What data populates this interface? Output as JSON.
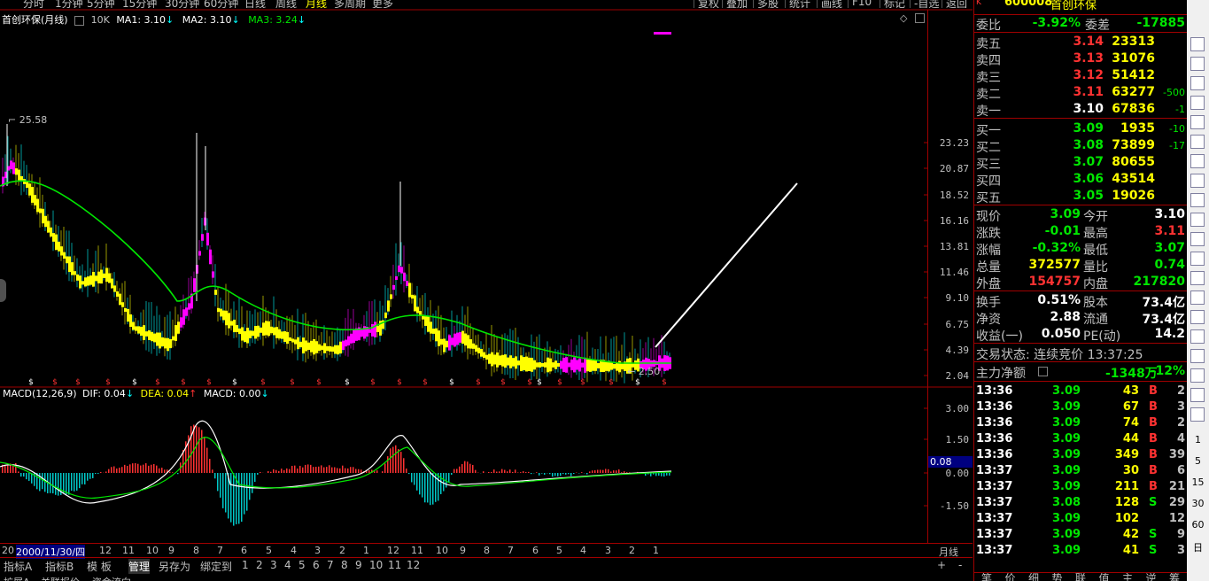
{
  "toolbar": {
    "periods": [
      "分时",
      "1分钟",
      "5分钟",
      "15分钟",
      "30分钟",
      "60分钟",
      "日线",
      "周线",
      "月线",
      "多周期",
      "更多"
    ],
    "active_period": "月线",
    "right_buttons": [
      "复权",
      "叠加",
      "多股",
      "统计",
      "画线",
      "F10",
      "标记",
      "-自选",
      "返回"
    ]
  },
  "main_chart": {
    "title": "首创环保(月线)",
    "vol_label": "10K",
    "ma1": "MA1: 3.10",
    "ma2": "MA2: 3.10",
    "ma3": "MA3: 3.24",
    "arrow": "↓",
    "y_ticks": [
      "23.23",
      "20.87",
      "18.52",
      "16.16",
      "13.81",
      "11.46",
      "9.10",
      "6.75",
      "4.39",
      "2.04"
    ],
    "high_label": "25.58",
    "low_label": "2.50",
    "colors": {
      "up": "#ff00ff",
      "down": "#ffff00",
      "ma_long": "#00e600",
      "frame": "#a00000"
    }
  },
  "macd": {
    "label": "MACD(12,26,9)",
    "dif": "DIF: 0.04",
    "dea": "DEA: 0.04",
    "macd_val": "MACD: 0.00",
    "y_ticks": [
      "3.00",
      "1.50",
      "0.00",
      "-1.50"
    ],
    "current": "0.08"
  },
  "date_axis": {
    "ticks": [
      "20",
      "2000/11/30/四",
      "12",
      "11",
      "10",
      "9",
      "8",
      "7",
      "6",
      "5",
      "4",
      "3",
      "2",
      "1",
      "12",
      "11",
      "10",
      "9",
      "8",
      "7",
      "6",
      "5",
      "4",
      "3",
      "2",
      "1"
    ],
    "period_label": "月线"
  },
  "tabs": {
    "items": [
      "指标A",
      "指标B",
      "模 板",
      "管理",
      "另存为",
      "绑定到",
      "1",
      "2",
      "3",
      "4",
      "5",
      "6",
      "7",
      "8",
      "9",
      "10",
      "11",
      "12"
    ],
    "active": "管理",
    "plus": "+",
    "minus": "-"
  },
  "extbar": {
    "items": [
      "扩展A",
      "关联报价",
      "资金流向"
    ]
  },
  "quote": {
    "code": "600008",
    "name": "首创环保",
    "weibi_label": "委比",
    "weibi": "-3.92%",
    "weicha_label": "委差",
    "weicha": "-17885",
    "sells": [
      {
        "label": "卖五",
        "price": "3.14",
        "vol": "23313",
        "chg": ""
      },
      {
        "label": "卖四",
        "price": "3.13",
        "vol": "31076",
        "chg": ""
      },
      {
        "label": "卖三",
        "price": "3.12",
        "vol": "51412",
        "chg": ""
      },
      {
        "label": "卖二",
        "price": "3.11",
        "vol": "63277",
        "chg": "-500"
      },
      {
        "label": "卖一",
        "price": "3.10",
        "vol": "67836",
        "chg": "-1"
      }
    ],
    "buys": [
      {
        "label": "买一",
        "price": "3.09",
        "vol": "1935",
        "chg": "-10"
      },
      {
        "label": "买二",
        "price": "3.08",
        "vol": "73899",
        "chg": "-17"
      },
      {
        "label": "买三",
        "price": "3.07",
        "vol": "80655",
        "chg": ""
      },
      {
        "label": "买四",
        "price": "3.06",
        "vol": "43514",
        "chg": ""
      },
      {
        "label": "买五",
        "price": "3.05",
        "vol": "19026",
        "chg": ""
      }
    ],
    "stats": [
      {
        "l1": "现价",
        "v1": "3.09",
        "l2": "今开",
        "v2": "3.10"
      },
      {
        "l1": "涨跌",
        "v1": "-0.01",
        "l2": "最高",
        "v2": "3.11"
      },
      {
        "l1": "涨幅",
        "v1": "-0.32%",
        "l2": "最低",
        "v2": "3.07"
      },
      {
        "l1": "总量",
        "v1": "372577",
        "l2": "量比",
        "v2": "0.74"
      },
      {
        "l1": "外盘",
        "v1": "154757",
        "l2": "内盘",
        "v2": "217820"
      }
    ],
    "stats2": [
      {
        "l1": "换手",
        "v1": "0.51%",
        "l2": "股本",
        "v2": "73.4亿"
      },
      {
        "l1": "净资",
        "v1": "2.88",
        "l2": "流通",
        "v2": "73.4亿"
      },
      {
        "l1": "收益(一)",
        "v1": "0.050",
        "l2": "PE(动)",
        "v2": "14.2"
      }
    ],
    "trade_status": "交易状态: 连续竞价 13:37:25",
    "main_flow_label": "主力净额",
    "main_flow": "-1348万",
    "main_flow_pct": "-12%"
  },
  "trades": [
    {
      "t": "13:36",
      "p": "3.09",
      "v": "43",
      "s": "B",
      "n": "2"
    },
    {
      "t": "13:36",
      "p": "3.09",
      "v": "67",
      "s": "B",
      "n": "3"
    },
    {
      "t": "13:36",
      "p": "3.09",
      "v": "74",
      "s": "B",
      "n": "2"
    },
    {
      "t": "13:36",
      "p": "3.09",
      "v": "44",
      "s": "B",
      "n": "4"
    },
    {
      "t": "13:36",
      "p": "3.09",
      "v": "349",
      "s": "B",
      "n": "39"
    },
    {
      "t": "13:37",
      "p": "3.09",
      "v": "30",
      "s": "B",
      "n": "6"
    },
    {
      "t": "13:37",
      "p": "3.09",
      "v": "211",
      "s": "B",
      "n": "21"
    },
    {
      "t": "13:37",
      "p": "3.08",
      "v": "128",
      "s": "S",
      "n": "29"
    },
    {
      "t": "13:37",
      "p": "3.09",
      "v": "102",
      "s": "",
      "n": "12"
    },
    {
      "t": "13:37",
      "p": "3.09",
      "v": "42",
      "s": "S",
      "n": "9"
    },
    {
      "t": "13:37",
      "p": "3.09",
      "v": "41",
      "s": "S",
      "n": "3"
    }
  ],
  "bottom_tabs": [
    "笔",
    "价",
    "细",
    "势",
    "联",
    "值",
    "主",
    "逆",
    "筹"
  ],
  "side_icons": [
    "K-icon",
    "chart-icon",
    "list-icon",
    "grid-icon",
    "line-icon",
    "bar-icon",
    "curve-icon",
    "table-icon",
    "cal-icon",
    "book-icon",
    "f10-icon",
    "fz-icon",
    "fund-icon",
    "refresh-icon",
    "rsi-icon",
    "layers-icon",
    "move-icon",
    "warn-icon",
    "f5-icon",
    "f6-icon"
  ],
  "side_nums": [
    "1",
    "5",
    "15",
    "30",
    "60",
    "日"
  ]
}
